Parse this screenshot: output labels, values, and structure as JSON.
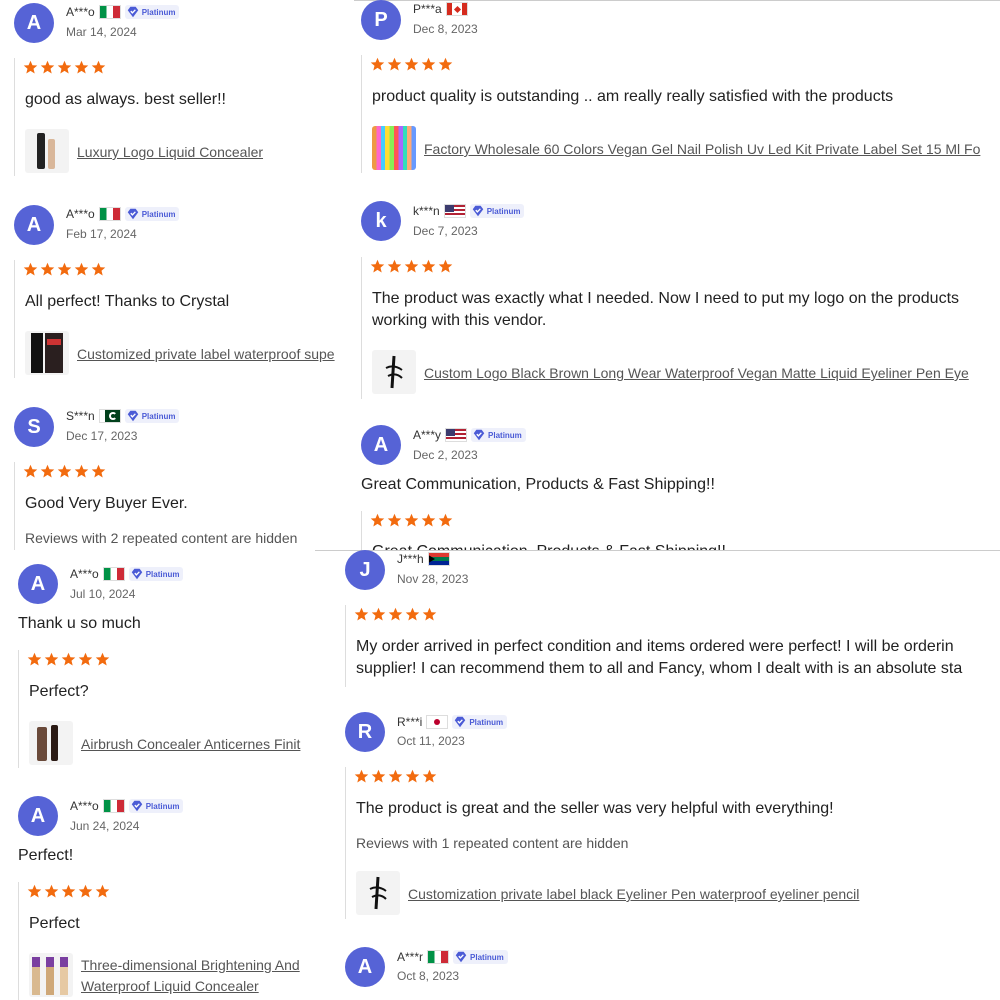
{
  "badge": "Platinum",
  "star_color": "#f26b0f",
  "avatar_color": "#5663d6",
  "panel_a": [
    {
      "initial": "A",
      "name": "A***o",
      "flag": "italy-flag",
      "platinum": true,
      "date": "Mar 14, 2024",
      "rating": 5,
      "text": "good as always. best seller!!",
      "product": "Luxury Logo Liquid Concealer"
    },
    {
      "initial": "A",
      "name": "A***o",
      "flag": "italy-flag",
      "platinum": true,
      "date": "Feb 17, 2024",
      "rating": 5,
      "text": "All perfect! Thanks to Crystal",
      "product": "Customized private label waterproof supe"
    },
    {
      "initial": "S",
      "name": "S***n",
      "flag": "pakistan-flag",
      "platinum": true,
      "date": "Dec 17, 2023",
      "rating": 5,
      "text": "Good Very Buyer Ever.",
      "hidden_note": "Reviews with 2 repeated content are hidden"
    }
  ],
  "panel_b": [
    {
      "initial": "P",
      "name": "P***a",
      "flag": "canada-flag",
      "platinum": false,
      "date": "Dec 8, 2023",
      "rating": 5,
      "text": "product quality is outstanding .. am really really satisfied with the products",
      "product": "Factory Wholesale 60 Colors Vegan Gel Nail Polish Uv Led Kit Private Label Set 15 Ml Fo"
    },
    {
      "initial": "k",
      "name": "k***n",
      "flag": "usa-flag",
      "platinum": true,
      "date": "Dec 7, 2023",
      "rating": 5,
      "text_lines": [
        "The product was exactly what I needed. Now I need to put my logo on the products",
        "working with this vendor."
      ],
      "product": "Custom Logo Black Brown Long Wear Waterproof Vegan Matte Liquid Eyeliner Pen Eye"
    },
    {
      "initial": "A",
      "name": "A***y",
      "flag": "usa-flag",
      "platinum": true,
      "date": "Dec 2, 2023",
      "text": "Great Communication, Products & Fast Shipping!!",
      "rating": 5,
      "reply": "Great Communication, Products & Fast Shipping!!"
    }
  ],
  "panel_c": [
    {
      "initial": "A",
      "name": "A***o",
      "flag": "italy-flag",
      "platinum": true,
      "date": "Jul 10, 2024",
      "text": "Thank u so much",
      "rating": 5,
      "reply": "Perfect?",
      "product": "Airbrush Concealer Anticernes Finit"
    },
    {
      "initial": "A",
      "name": "A***o",
      "flag": "italy-flag",
      "platinum": true,
      "date": "Jun 24, 2024",
      "text": "Perfect!",
      "rating": 5,
      "reply": "Perfect",
      "product_lines": [
        "Three-dimensional Brightening And",
        "Waterproof Liquid Concealer"
      ]
    }
  ],
  "panel_d": [
    {
      "initial": "J",
      "name": "J***h",
      "flag": "south-africa-flag",
      "platinum": false,
      "date": "Nov 28, 2023",
      "rating": 5,
      "text_lines": [
        "My order arrived in perfect condition and items ordered were perfect! I will be orderin",
        "supplier! I can recommend them to all and Fancy, whom I dealt with is an absolute sta"
      ]
    },
    {
      "initial": "R",
      "name": "R***i",
      "flag": "japan-flag",
      "platinum": true,
      "date": "Oct 11, 2023",
      "rating": 5,
      "text": "The product is great and the seller was very helpful with everything!",
      "hidden_note": "Reviews with 1 repeated content are hidden",
      "product": "Customization private label black Eyeliner Pen waterproof eyeliner pencil"
    },
    {
      "initial": "A",
      "name": "A***r",
      "flag": "italy-flag",
      "platinum": true,
      "date": "Oct 8, 2023"
    }
  ]
}
